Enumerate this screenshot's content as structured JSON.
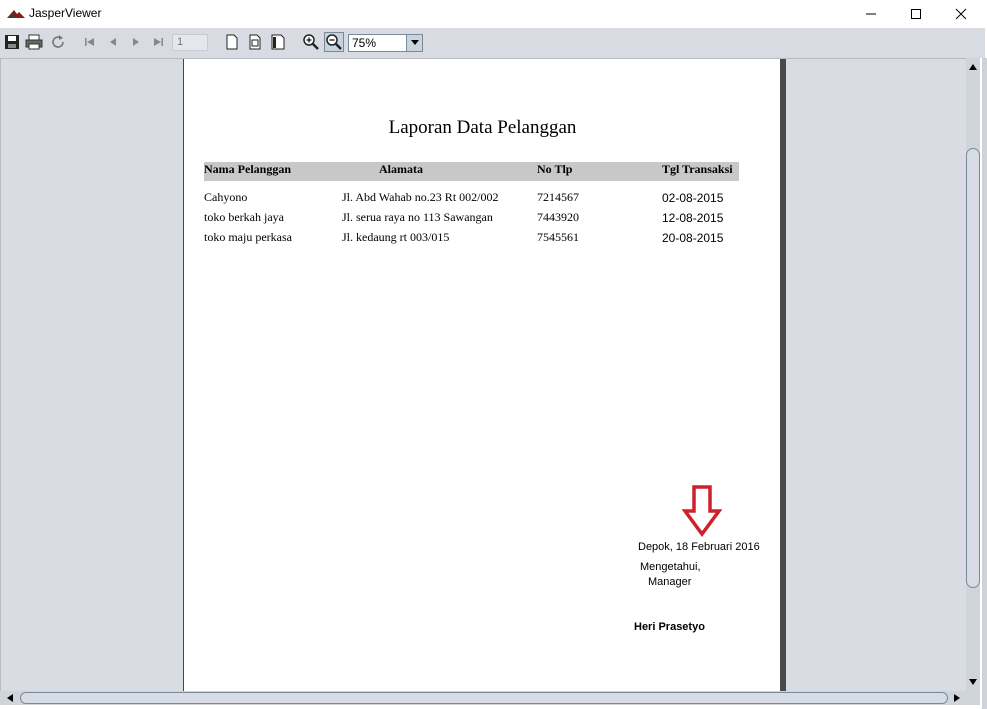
{
  "window": {
    "title": "JasperViewer",
    "controls": [
      "minimize-icon",
      "maximize-icon",
      "close-icon"
    ]
  },
  "toolbar": {
    "page_number": "1",
    "zoom_value": "75%",
    "buttons": [
      "save-icon",
      "print-icon",
      "reload-icon",
      "first-page-icon",
      "previous-page-icon",
      "next-page-icon",
      "last-page-icon",
      "actual-size-icon",
      "fit-page-icon",
      "fit-width-icon",
      "zoom-in-icon",
      "zoom-out-icon"
    ]
  },
  "report": {
    "title": "Laporan Data Pelanggan",
    "columns": [
      "Nama Pelanggan",
      "Alamata",
      "No Tlp",
      "Tgl Transaksi"
    ],
    "rows": [
      [
        "Cahyono",
        "Jl. Abd Wahab no.23 Rt 002/002",
        "7214567",
        "02-08-2015"
      ],
      [
        "toko berkah jaya",
        "Jl. serua raya no 113 Sawangan",
        "7443920",
        "12-08-2015"
      ],
      [
        "toko maju perkasa",
        "Jl. kedaung rt 003/015",
        "7545561",
        "20-08-2015"
      ]
    ],
    "signature": {
      "place_date": "Depok, 18 Februari 2016",
      "acknowledge": "Mengetahui,",
      "role": "Manager",
      "name": "Heri Prasetyo"
    }
  },
  "colors": {
    "annotation_arrow": "#d0202a",
    "toolbar_bg": "#d8dce2",
    "header_bar": "#c8c8c8"
  }
}
